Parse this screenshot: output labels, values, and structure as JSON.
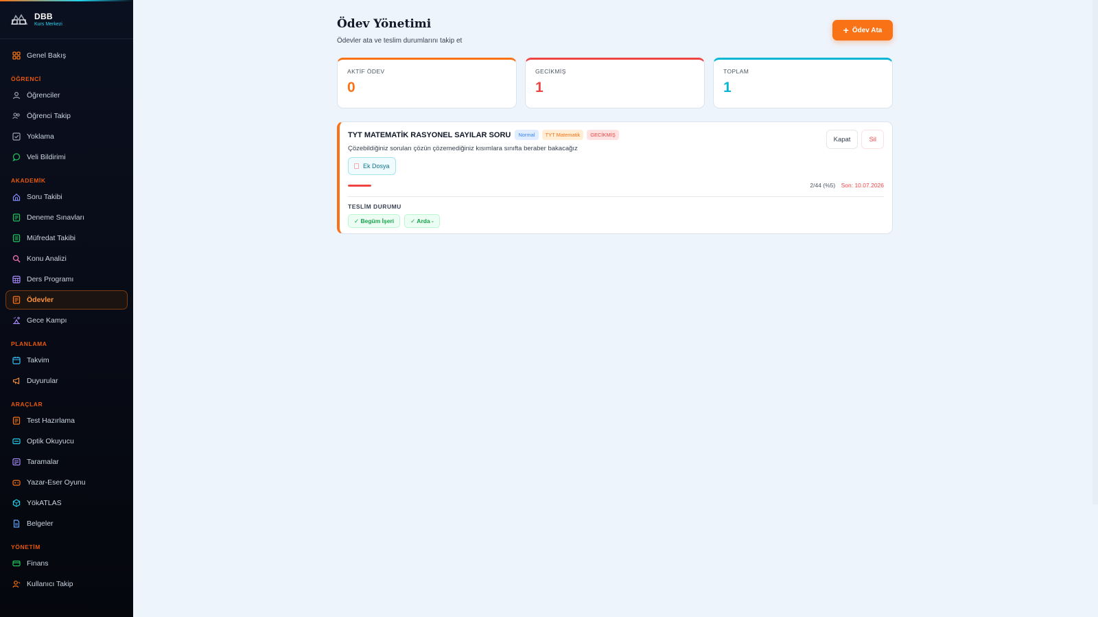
{
  "brand": {
    "name": "DBB",
    "subtitle": "Kurs Merkezi"
  },
  "sidebar": {
    "top_item": {
      "label": "Genel Bakış",
      "icon": "grid-icon"
    },
    "sections": [
      {
        "title": "ÖĞRENCİ",
        "items": [
          {
            "label": "Öğrenciler",
            "icon": "user-icon",
            "color": "#9ca3af"
          },
          {
            "label": "Öğrenci Takip",
            "icon": "users-icon",
            "color": "#9ca3af"
          },
          {
            "label": "Yoklama",
            "icon": "checkbox-icon",
            "color": "#9ca3af"
          },
          {
            "label": "Veli Bildirimi",
            "icon": "message-icon",
            "color": "#22c55e"
          }
        ]
      },
      {
        "title": "AKADEMİK",
        "items": [
          {
            "label": "Soru Takibi",
            "icon": "home-icon",
            "color": "#818cf8"
          },
          {
            "label": "Deneme Sınavları",
            "icon": "doc-icon",
            "color": "#22c55e"
          },
          {
            "label": "Müfredat Takibi",
            "icon": "book-icon",
            "color": "#22c55e"
          },
          {
            "label": "Konu Analizi",
            "icon": "magnifier-icon",
            "color": "#f472b6"
          },
          {
            "label": "Ders Programı",
            "icon": "calendar-grid-icon",
            "color": "#a78bfa"
          },
          {
            "label": "Ödevler",
            "icon": "homework-icon",
            "color": "#f97316",
            "active": true
          },
          {
            "label": "Gece Kampı",
            "icon": "camp-icon",
            "color": "#a78bfa"
          }
        ]
      },
      {
        "title": "PLANLAMA",
        "items": [
          {
            "label": "Takvim",
            "icon": "calendar-icon",
            "color": "#38bdf8"
          },
          {
            "label": "Duyurular",
            "icon": "megaphone-icon",
            "color": "#fb923c"
          }
        ]
      },
      {
        "title": "ARAÇLAR",
        "items": [
          {
            "label": "Test Hazırlama",
            "icon": "test-icon",
            "color": "#f97316"
          },
          {
            "label": "Optik Okuyucu",
            "icon": "scanner-icon",
            "color": "#22d3ee"
          },
          {
            "label": "Taramalar",
            "icon": "scan-list-icon",
            "color": "#a78bfa"
          },
          {
            "label": "Yazar-Eser Oyunu",
            "icon": "game-icon",
            "color": "#f97316"
          },
          {
            "label": "YökATLAS",
            "icon": "atlas-icon",
            "color": "#22d3ee"
          },
          {
            "label": "Belgeler",
            "icon": "file-icon",
            "color": "#60a5fa"
          }
        ]
      },
      {
        "title": "YÖNETİM",
        "items": [
          {
            "label": "Finans",
            "icon": "card-icon",
            "color": "#22c55e"
          },
          {
            "label": "Kullanıcı Takip",
            "icon": "user-track-icon",
            "color": "#f97316"
          }
        ]
      }
    ]
  },
  "header": {
    "title": "Ödev Yönetimi",
    "subtitle": "Ödevler ata ve teslim durumlarını takip et",
    "assign_button": "Ödev Ata"
  },
  "stats": [
    {
      "label": "AKTİF ÖDEV",
      "value": "0",
      "color": "#f97316"
    },
    {
      "label": "GECİKMİŞ",
      "value": "1",
      "color": "#ef4444"
    },
    {
      "label": "TOPLAM",
      "value": "1",
      "color": "#06b6d4"
    }
  ],
  "homework": {
    "title": "TYT MATEMATİK RASYONEL SAYILAR SORU",
    "tags": {
      "priority": "Normal",
      "subject": "TYT Matematik",
      "status": "GECİKMİŞ"
    },
    "description": "Çözebildiğiniz soruları çözün çözemediğiniz kısımlara sınıfta beraber bakacağız",
    "attachment": "Ek Dosya",
    "close_button": "Kapat",
    "delete_button": "Sil",
    "progress": {
      "fraction": 0.05,
      "count_text": "2/44 (%5)",
      "due_text": "Son: 10.07.2026"
    },
    "submission_title": "TESLİM DURUMU",
    "submissions": [
      "✓ Begüm İşeri",
      "✓ Arda -"
    ]
  }
}
